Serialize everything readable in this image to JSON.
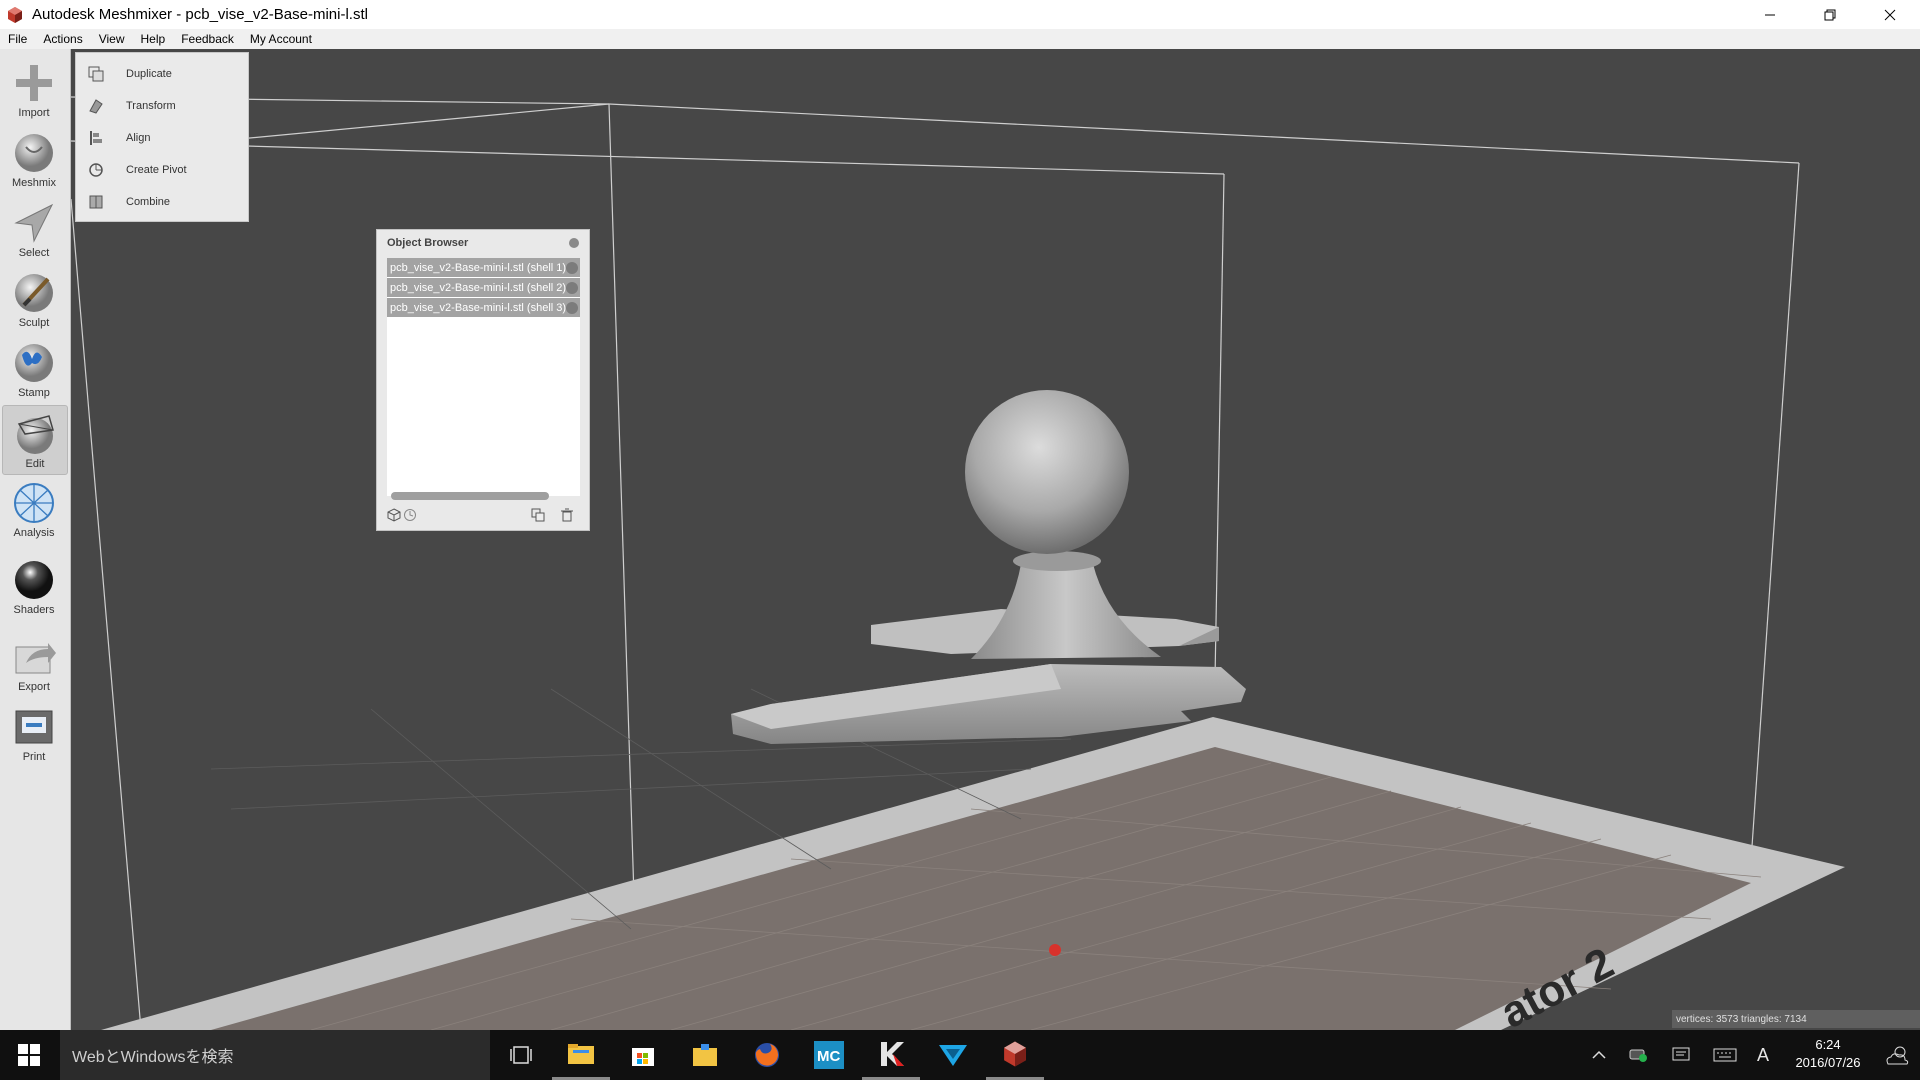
{
  "window": {
    "title": "Autodesk Meshmixer - pcb_vise_v2-Base-mini-l.stl"
  },
  "menubar": {
    "items": [
      "File",
      "Actions",
      "View",
      "Help",
      "Feedback",
      "My Account"
    ]
  },
  "toolbar": {
    "items": [
      {
        "label": "Import",
        "icon": "plus-icon"
      },
      {
        "label": "Meshmix",
        "icon": "meshmix-icon"
      },
      {
        "label": "Select",
        "icon": "select-arrow-icon"
      },
      {
        "label": "Sculpt",
        "icon": "sculpt-brush-icon"
      },
      {
        "label": "Stamp",
        "icon": "stamp-icon"
      },
      {
        "label": "Edit",
        "icon": "edit-icon",
        "active": true
      },
      {
        "label": "Analysis",
        "icon": "analysis-icon"
      },
      {
        "label": "Shaders",
        "icon": "shaders-icon"
      },
      {
        "label": "Export",
        "icon": "export-icon"
      },
      {
        "label": "Print",
        "icon": "print-icon"
      }
    ]
  },
  "edit_menu": {
    "items": [
      "Duplicate",
      "Transform",
      "Align",
      "Create Pivot",
      "Combine"
    ]
  },
  "object_browser": {
    "title": "Object Browser",
    "items": [
      "pcb_vise_v2-Base-mini-l.stl (shell 1)",
      "pcb_vise_v2-Base-mini-l.stl (shell 2)",
      "pcb_vise_v2-Base-mini-l.stl (shell 3)"
    ]
  },
  "viewport": {
    "bed_label": "ator 2"
  },
  "status": {
    "stats": "vertices: 3573 triangles: 7134"
  },
  "taskbar": {
    "search_placeholder": "WebとWindowsを検索",
    "time": "6:24",
    "date": "2016/07/26",
    "ime": "A"
  }
}
